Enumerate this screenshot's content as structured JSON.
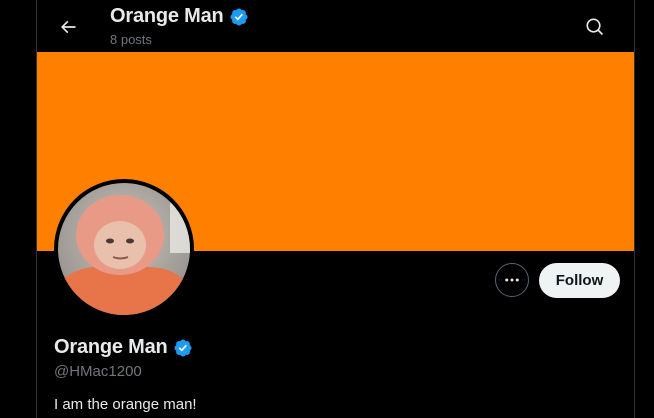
{
  "header": {
    "name": "Orange Man",
    "posts_count": "8 posts",
    "back_icon": "arrow-left-icon",
    "search_icon": "search-icon"
  },
  "banner": {
    "color": "#ff8000"
  },
  "profile": {
    "display_name": "Orange Man",
    "handle": "@HMac1200",
    "bio": "I am the orange man!",
    "verified_color": "#1d9bf0"
  },
  "actions": {
    "more_icon": "more-horizontal-icon",
    "follow_label": "Follow"
  }
}
